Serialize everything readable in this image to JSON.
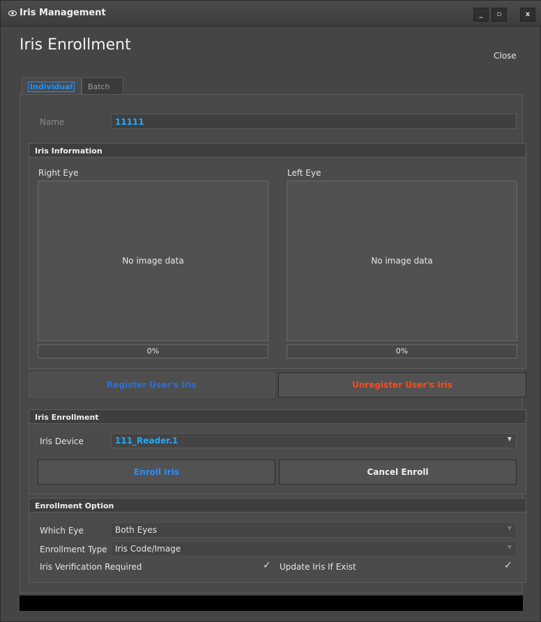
{
  "window": {
    "title": "Iris Management",
    "controls": {
      "minimize": "_",
      "maximize": "▫",
      "close": "x"
    }
  },
  "header": {
    "title": "Iris Enrollment",
    "close_label": "Close"
  },
  "tabs": [
    {
      "label": "Individual",
      "active": true
    },
    {
      "label": "Batch",
      "active": false
    }
  ],
  "name": {
    "label": "Name",
    "value": "11111"
  },
  "iris_information": {
    "heading": "Iris Information",
    "right_eye": {
      "label": "Right Eye",
      "image_text": "No image data",
      "progress": "0%"
    },
    "left_eye": {
      "label": "Left Eye",
      "image_text": "No image data",
      "progress": "0%"
    }
  },
  "actions": {
    "register": "Register User's Iris",
    "unregister": "Unregister User's Iris"
  },
  "iris_enrollment": {
    "heading": "Iris Enrollment",
    "device_label": "Iris Device",
    "device_value": "111_Reader.1",
    "enroll_button": "Enroll Iris",
    "cancel_button": "Cancel Enroll"
  },
  "enrollment_option": {
    "heading": "Enrollment Option",
    "which_eye_label": "Which Eye",
    "which_eye_value": "Both Eyes",
    "type_label": "Enrollment Type",
    "type_value": "Iris Code/Image",
    "verification_label": "Iris Verification Required",
    "verification_checked": true,
    "update_label": "Update Iris If Exist",
    "update_checked": true
  },
  "colors": {
    "accent_blue": "#1e90ff",
    "value_cyan": "#1eaaff",
    "danger_orange": "#ff4a1a",
    "register_blue": "#2d6fd6"
  }
}
